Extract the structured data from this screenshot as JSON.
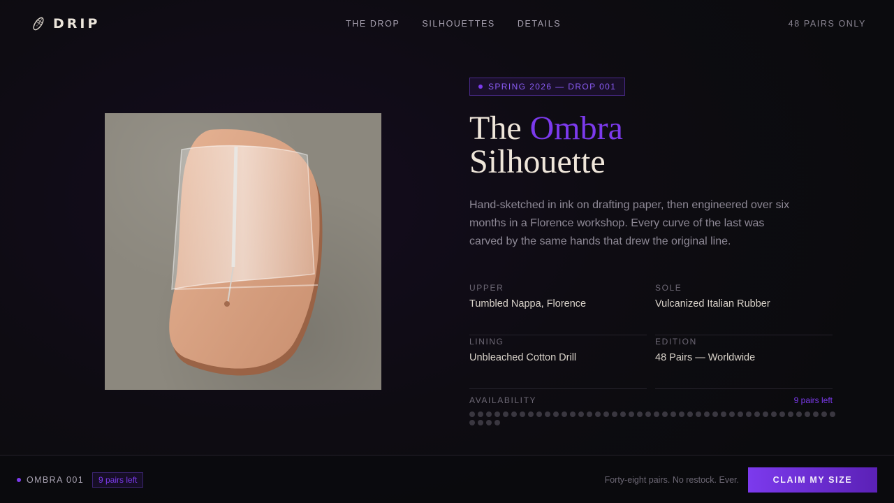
{
  "brand": {
    "name": "DRIP",
    "logo_icon": "shoe-icon"
  },
  "nav": {
    "items": [
      "THE DROP",
      "SILHOUETTES",
      "DETAILS"
    ]
  },
  "header": {
    "right_text": "48 PAIRS ONLY"
  },
  "hero": {
    "badge": "SPRING 2026 — DROP 001",
    "title_part1": "The ",
    "title_accent": "Ombra",
    "title_part2": "Silhouette",
    "description": "Hand-sketched in ink on drafting paper, then engineered over six months in a Florence workshop. Every curve of the last was carved by the same hands that drew the original line."
  },
  "specs": [
    {
      "label": "UPPER",
      "value": "Tumbled Nappa, Florence"
    },
    {
      "label": "SOLE",
      "value": "Vulcanized Italian Rubber"
    },
    {
      "label": "LINING",
      "value": "Unbleached Cotton Drill"
    },
    {
      "label": "EDITION",
      "value": "48 Pairs — Worldwide"
    }
  ],
  "availability": {
    "label": "AVAILABILITY",
    "count_text": "9 pairs left",
    "total": 48,
    "remaining": 9
  },
  "footer": {
    "product": "OMBRA 001",
    "badge": "9 pairs left",
    "note": "Forty-eight pairs. No restock. Ever.",
    "cta": "CLAIM MY SIZE"
  },
  "colors": {
    "accent": "#7c3aed",
    "background": "#0e0c12",
    "text": "#efe6da"
  }
}
